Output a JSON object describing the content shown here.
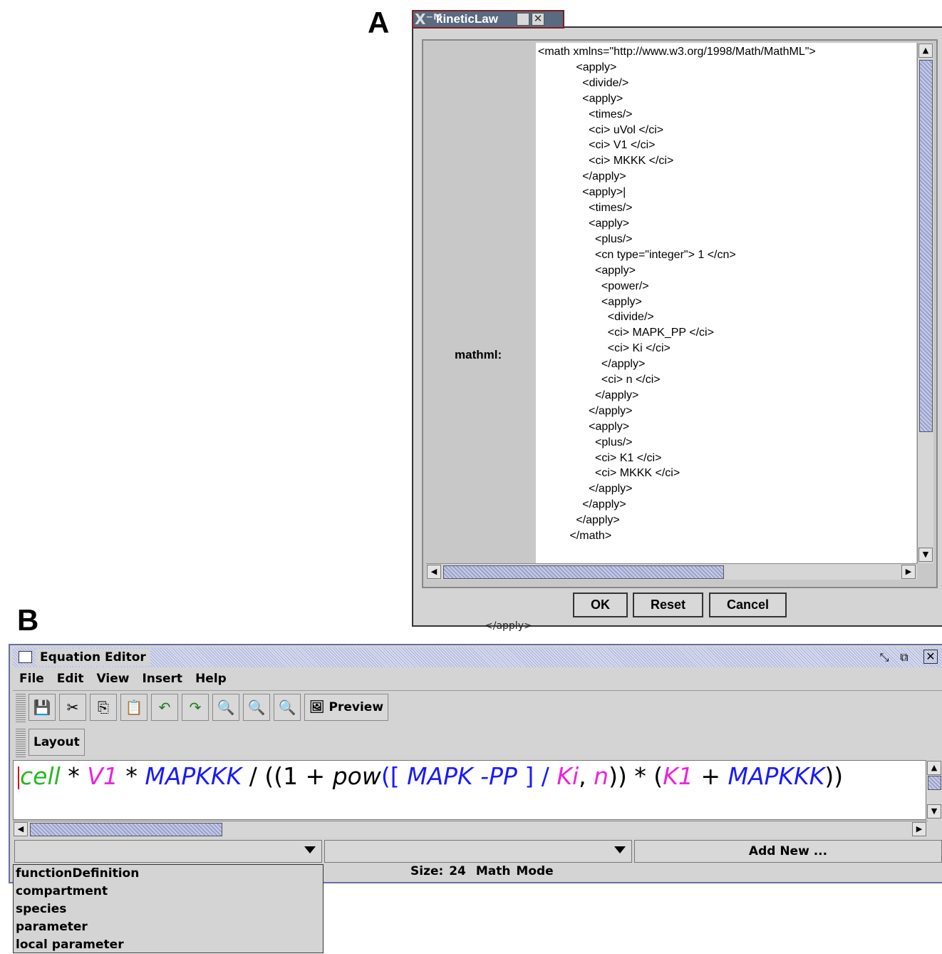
{
  "panel_labels": {
    "a": "A",
    "b": "B"
  },
  "kinetic_law_dialog": {
    "title": "kineticLaw",
    "field_label": "mathml:",
    "mathml_lines": [
      "<math xmlns=\"http://www.w3.org/1998/Math/MathML\">",
      "            <apply>",
      "              <divide/>",
      "              <apply>",
      "                <times/>",
      "                <ci> uVol </ci>",
      "                <ci> V1 </ci>",
      "                <ci> MKKK </ci>",
      "              </apply>",
      "              <apply>|",
      "                <times/>",
      "                <apply>",
      "                  <plus/>",
      "                  <cn type=\"integer\"> 1 </cn>",
      "                  <apply>",
      "                    <power/>",
      "                    <apply>",
      "                      <divide/>",
      "                      <ci> MAPK_PP </ci>",
      "                      <ci> Ki </ci>",
      "                    </apply>",
      "                    <ci> n </ci>",
      "                  </apply>",
      "                </apply>",
      "                <apply>",
      "                  <plus/>",
      "                  <ci> K1 </ci>",
      "                  <ci> MKKK </ci>",
      "                </apply>",
      "              </apply>",
      "            </apply>",
      "          </math>"
    ],
    "buttons": {
      "ok": "OK",
      "reset": "Reset",
      "cancel": "Cancel"
    },
    "behind_text": "</apply>"
  },
  "equation_editor": {
    "title": "Equation Editor",
    "menu": [
      "File",
      "Edit",
      "View",
      "Insert",
      "Help"
    ],
    "toolbar": {
      "preview": "Preview",
      "layout": "Layout"
    },
    "equation": {
      "cell": "cell",
      "star1": " * ",
      "v1": "V1",
      "star2": " * ",
      "mapkkk": "MAPKKK",
      "div1": "  / ((1  + ",
      "pow": "pow",
      "open": "([ ",
      "mapkpp": "MAPK -PP",
      "close": " ]  / ",
      "ki": "Ki",
      "comma": ", ",
      "n": "n",
      "mid": ")) * (",
      "k1": "K1",
      "plus": "  + ",
      "mapkkk2": "MAPKKK",
      "end": "))"
    },
    "colors": {
      "green": "#22bb22",
      "magenta": "#ee22dd",
      "blue": "#1a1aff",
      "black": "#000000"
    },
    "add_new": "Add New ...",
    "status": {
      "size": "Size: 24",
      "mode": "Math Mode"
    },
    "dropdown_items": [
      "functionDefinition",
      "compartment",
      "species",
      "parameter",
      "local parameter"
    ]
  }
}
